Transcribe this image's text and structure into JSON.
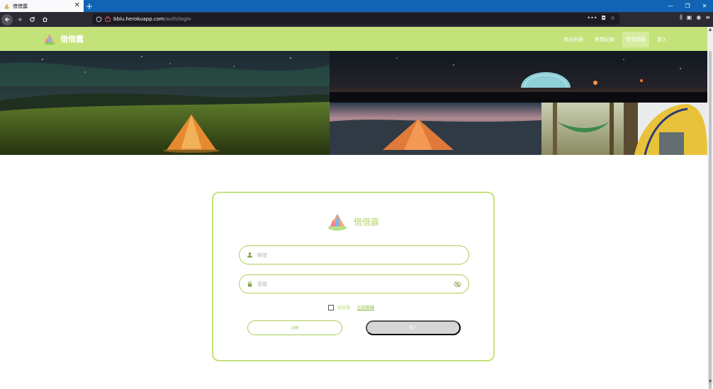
{
  "browser": {
    "tab_title": "借借露",
    "tab_close_glyph": "✕",
    "new_tab_glyph": "+",
    "url_host": "bblu.herokuapp.com",
    "url_path": "/auth/login",
    "window_controls": [
      "—",
      "❐",
      "✕"
    ]
  },
  "site": {
    "brand_name": "借借露",
    "nav": [
      {
        "label": "商品列表",
        "active": false
      },
      {
        "label": "租借紀錄",
        "active": false
      },
      {
        "label": "常見問題",
        "active": true
      },
      {
        "label": "登入",
        "active": false
      }
    ]
  },
  "login": {
    "title": "借借露",
    "account_placeholder": "帳號",
    "password_placeholder": "密碼",
    "remember_label": "記住我",
    "forgot_label": "忘記密碼",
    "register_label": "註冊",
    "login_label": "登入"
  },
  "colors": {
    "brand_green": "#c3e27a",
    "browser_blue": "#1164b4",
    "toolbar_dark": "#2b2a33",
    "disabled_gray": "#d6d6d6"
  },
  "icons": {
    "account_field": "person-icon",
    "password_field": "lock-icon",
    "password_toggle": "eye-slash-icon"
  }
}
